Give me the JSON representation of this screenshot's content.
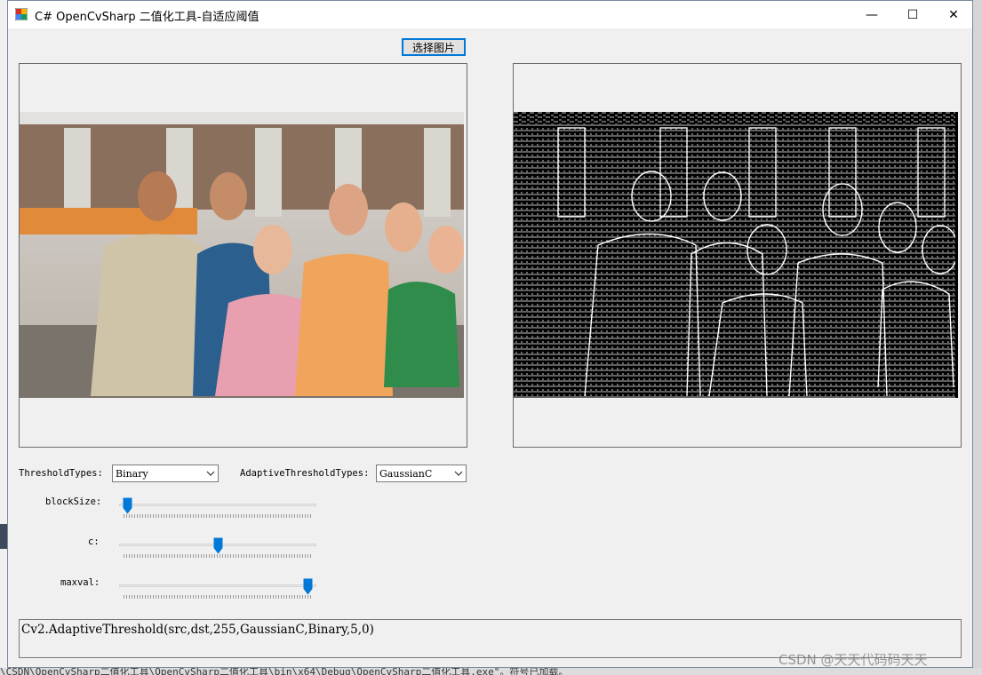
{
  "window": {
    "title": "C# OpenCvSharp 二值化工具-自适应阈值",
    "minimize_glyph": "—",
    "maximize_glyph": "☐",
    "close_glyph": "✕"
  },
  "toolbar": {
    "select_image_label": "选择图片"
  },
  "controls": {
    "threshold_types_label": "ThresholdTypes:",
    "threshold_types_value": "Binary",
    "adaptive_types_label": "AdaptiveThresholdTypes:",
    "adaptive_types_value": "GaussianC",
    "sliders": [
      {
        "label": "blockSize:",
        "position": 0.0
      },
      {
        "label": "c:",
        "position": 0.5
      },
      {
        "label": "maxval:",
        "position": 1.0
      }
    ]
  },
  "output": {
    "command_text": "Cv2.AdaptiveThreshold(src,dst,255,GaussianC,Binary,5,0)"
  },
  "background": {
    "status_line": "\\CSDN\\OpenCvSharp二值化工具\\OpenCvSharp二值化工具\\bin\\x64\\Debug\\OpenCvSharp二值化工具.exe\"。符号已加载。"
  },
  "watermark": "CSDN @天天代码码天天",
  "colors": {
    "accent": "#0078d7",
    "window_bg": "#f0f0f0",
    "titlebar_bg": "#ffffff"
  },
  "icons": [
    "app-icon",
    "minimize-icon",
    "maximize-icon",
    "close-icon",
    "chevron-down-icon"
  ]
}
